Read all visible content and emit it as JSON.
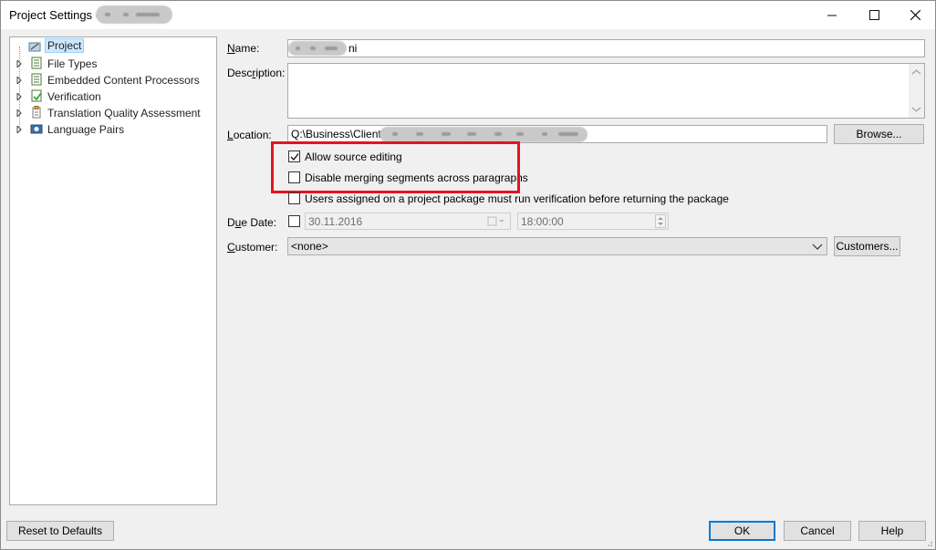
{
  "window": {
    "title": "Project Settings -",
    "controls": {
      "minimize": "minimize",
      "maximize": "maximize",
      "close": "close"
    }
  },
  "tree": {
    "items": [
      {
        "label": "Project",
        "icon": "project-icon",
        "selected": true,
        "expandable": false
      },
      {
        "label": "File Types",
        "icon": "file-types-icon",
        "selected": false,
        "expandable": true
      },
      {
        "label": "Embedded Content Processors",
        "icon": "embedded-content-icon",
        "selected": false,
        "expandable": true
      },
      {
        "label": "Verification",
        "icon": "verification-icon",
        "selected": false,
        "expandable": true
      },
      {
        "label": "Translation Quality Assessment",
        "icon": "tqa-icon",
        "selected": false,
        "expandable": true
      },
      {
        "label": "Language Pairs",
        "icon": "language-pairs-icon",
        "selected": false,
        "expandable": true
      }
    ]
  },
  "form": {
    "name_label": "Name:",
    "name_value_suffix": "ni",
    "description_label": "Description:",
    "description_value": "",
    "location_label": "Location:",
    "location_value": "Q:\\Business\\Clients\\",
    "browse_label": "Browse...",
    "allow_source_editing_label": "Allow source editing",
    "allow_source_editing_checked": true,
    "disable_merging_label": "Disable merging segments across paragraphs",
    "disable_merging_checked": false,
    "users_verification_label": "Users assigned on a project package must run verification before returning the package",
    "users_verification_checked": false,
    "due_date_label": "Due Date:",
    "due_date_checked": false,
    "due_date_value": "30.11.2016",
    "due_time_value": "18:00:00",
    "customer_label": "Customer:",
    "customer_value": "<none>",
    "customers_button_label": "Customers..."
  },
  "footer": {
    "reset_label": "Reset to Defaults",
    "ok_label": "OK",
    "cancel_label": "Cancel",
    "help_label": "Help"
  },
  "colors": {
    "highlight_border": "#e81123",
    "default_button_border": "#0078d7",
    "selection": "#cce8ff"
  }
}
